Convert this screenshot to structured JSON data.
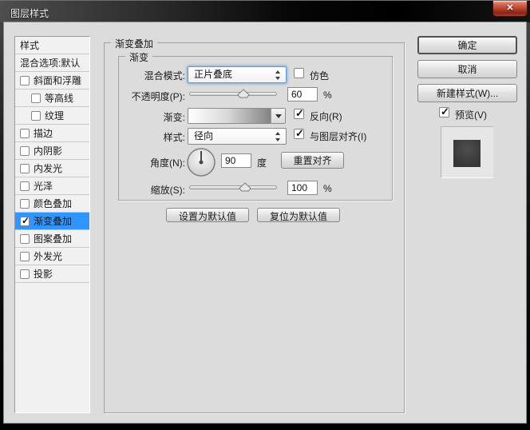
{
  "window": {
    "title": "图层样式",
    "close_glyph": "✕"
  },
  "colors": {
    "selection_blue": "#3095fe",
    "close_button_red": "#b33f2b",
    "dialog_bg": "#dcdcdc",
    "gradient_start": "#ffffff",
    "gradient_end": "#6b6b6b"
  },
  "sidebar": {
    "items": [
      {
        "label": "样式",
        "checkbox": false,
        "checked": false,
        "selected": false
      },
      {
        "label": "混合选项:默认",
        "checkbox": false,
        "checked": false,
        "selected": false
      },
      {
        "label": "斜面和浮雕",
        "checkbox": true,
        "checked": false,
        "selected": false
      },
      {
        "label": "等高线",
        "checkbox": true,
        "checked": false,
        "selected": false,
        "indent": true
      },
      {
        "label": "纹理",
        "checkbox": true,
        "checked": false,
        "selected": false,
        "indent": true
      },
      {
        "label": "描边",
        "checkbox": true,
        "checked": false,
        "selected": false
      },
      {
        "label": "内阴影",
        "checkbox": true,
        "checked": false,
        "selected": false
      },
      {
        "label": "内发光",
        "checkbox": true,
        "checked": false,
        "selected": false
      },
      {
        "label": "光泽",
        "checkbox": true,
        "checked": false,
        "selected": false
      },
      {
        "label": "颜色叠加",
        "checkbox": true,
        "checked": false,
        "selected": false
      },
      {
        "label": "渐变叠加",
        "checkbox": true,
        "checked": true,
        "selected": true
      },
      {
        "label": "图案叠加",
        "checkbox": true,
        "checked": false,
        "selected": false
      },
      {
        "label": "外发光",
        "checkbox": true,
        "checked": false,
        "selected": false
      },
      {
        "label": "投影",
        "checkbox": true,
        "checked": false,
        "selected": false
      }
    ]
  },
  "panel": {
    "legend": "渐变叠加",
    "sub_legend": "渐变",
    "blend_mode_label": "混合模式:",
    "blend_mode_value": "正片叠底",
    "dither_label": "仿色",
    "dither_checked": false,
    "opacity_label": "不透明度(P):",
    "opacity_value": "60",
    "opacity_unit": "%",
    "gradient_label": "渐变:",
    "reverse_label": "反向(R)",
    "reverse_checked": true,
    "style_label": "样式:",
    "style_value": "径向",
    "align_label": "与图层对齐(I)",
    "align_checked": true,
    "angle_label": "角度(N):",
    "angle_value": "90",
    "angle_unit": "度",
    "reset_align_button": "重置对齐",
    "scale_label": "缩放(S):",
    "scale_value": "100",
    "scale_unit": "%",
    "set_default_button": "设置为默认值",
    "reset_default_button": "复位为默认值"
  },
  "actions": {
    "ok": "确定",
    "cancel": "取消",
    "new_style": "新建样式(W)...",
    "preview_label": "预览(V)",
    "preview_checked": true
  }
}
